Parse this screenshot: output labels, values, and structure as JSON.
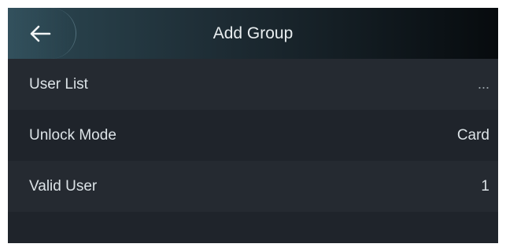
{
  "header": {
    "title": "Add Group",
    "back_icon": "arrow-left-icon"
  },
  "rows": [
    {
      "label": "User List",
      "value": "..."
    },
    {
      "label": "Unlock Mode",
      "value": "Card"
    },
    {
      "label": "Valid User",
      "value": "1"
    }
  ],
  "colors": {
    "background": "#1f242b",
    "row_alt": "#252a31",
    "header_start": "#2c4853",
    "header_end": "#070b0e",
    "text": "#dce3e7"
  }
}
